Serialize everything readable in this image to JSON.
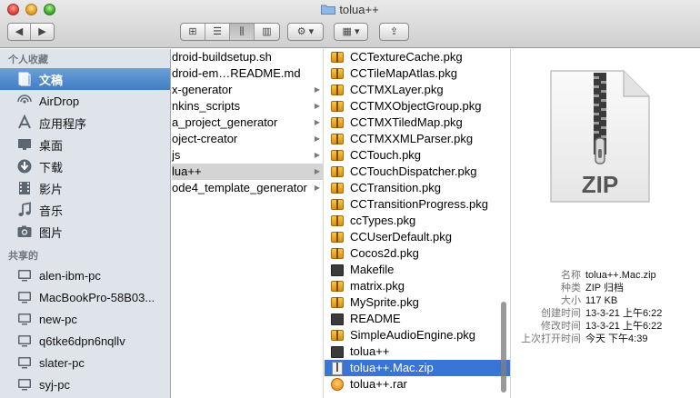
{
  "window": {
    "title": "tolua++"
  },
  "toolbar": {
    "back_glyph": "◀",
    "forward_glyph": "▶",
    "view_icon_glyph": "⊞",
    "view_list_glyph": "☰",
    "view_columns_glyph": "⫼",
    "view_coverflow_glyph": "▥",
    "action_glyph": "⚙ ▾",
    "arrange_glyph": "▦ ▾",
    "share_glyph": "⇪"
  },
  "sidebar": {
    "favorites_header": "个人收藏",
    "favorites": [
      {
        "label": "文稿",
        "icon": "documents-icon"
      },
      {
        "label": "AirDrop",
        "icon": "airdrop-icon"
      },
      {
        "label": "应用程序",
        "icon": "applications-icon"
      },
      {
        "label": "桌面",
        "icon": "desktop-icon"
      },
      {
        "label": "下载",
        "icon": "downloads-icon"
      },
      {
        "label": "影片",
        "icon": "movies-icon"
      },
      {
        "label": "音乐",
        "icon": "music-icon"
      },
      {
        "label": "图片",
        "icon": "pictures-icon"
      }
    ],
    "shared_header": "共享的",
    "shared": [
      {
        "label": "alen-ibm-pc"
      },
      {
        "label": "MacBookPro-58B03..."
      },
      {
        "label": "new-pc"
      },
      {
        "label": "q6tke6dpn6nqllv"
      },
      {
        "label": "slater-pc"
      },
      {
        "label": "syj-pc"
      }
    ]
  },
  "column1": {
    "items": [
      {
        "label": "droid-buildsetup.sh",
        "folder": false
      },
      {
        "label": "droid-em…README.md",
        "folder": false
      },
      {
        "label": "x-generator",
        "folder": true
      },
      {
        "label": "nkins_scripts",
        "folder": true
      },
      {
        "label": "a_project_generator",
        "folder": true
      },
      {
        "label": "oject-creator",
        "folder": true
      },
      {
        "label": "js",
        "folder": true
      },
      {
        "label": "lua++",
        "folder": true
      },
      {
        "label": "ode4_template_generator",
        "folder": true
      }
    ]
  },
  "column2": {
    "items": [
      {
        "label": "CCTextureCache.pkg",
        "icon": "package-icon"
      },
      {
        "label": "CCTileMapAtlas.pkg",
        "icon": "package-icon"
      },
      {
        "label": "CCTMXLayer.pkg",
        "icon": "package-icon"
      },
      {
        "label": "CCTMXObjectGroup.pkg",
        "icon": "package-icon"
      },
      {
        "label": "CCTMXTiledMap.pkg",
        "icon": "package-icon"
      },
      {
        "label": "CCTMXXMLParser.pkg",
        "icon": "package-icon"
      },
      {
        "label": "CCTouch.pkg",
        "icon": "package-icon"
      },
      {
        "label": "CCTouchDispatcher.pkg",
        "icon": "package-icon"
      },
      {
        "label": "CCTransition.pkg",
        "icon": "package-icon"
      },
      {
        "label": "CCTransitionProgress.pkg",
        "icon": "package-icon"
      },
      {
        "label": "ccTypes.pkg",
        "icon": "package-icon"
      },
      {
        "label": "CCUserDefault.pkg",
        "icon": "package-icon"
      },
      {
        "label": "Cocos2d.pkg",
        "icon": "package-icon"
      },
      {
        "label": "Makefile",
        "icon": "unix-executable-icon"
      },
      {
        "label": "matrix.pkg",
        "icon": "package-icon"
      },
      {
        "label": "MySprite.pkg",
        "icon": "package-icon"
      },
      {
        "label": "README",
        "icon": "unix-executable-icon"
      },
      {
        "label": "SimpleAudioEngine.pkg",
        "icon": "package-icon"
      },
      {
        "label": "tolua++",
        "icon": "unix-executable-icon"
      },
      {
        "label": "tolua++.Mac.zip",
        "icon": "zip-file-icon"
      },
      {
        "label": "tolua++.rar",
        "icon": "rar-file-icon"
      }
    ]
  },
  "preview": {
    "icon_label": "ZIP",
    "meta": [
      {
        "key": "名称",
        "value": "tolua++.Mac.zip"
      },
      {
        "key": "种类",
        "value": "ZIP 归档"
      },
      {
        "key": "大小",
        "value": "117 KB"
      },
      {
        "key": "创建时间",
        "value": "13-3-21 上午6:22"
      },
      {
        "key": "修改时间",
        "value": "13-3-21 上午6:22"
      },
      {
        "key": "上次打开时间",
        "value": "今天 下午4:39"
      }
    ]
  },
  "colors": {
    "selection_blue": "#3875d7",
    "sidebar_bg": "#dfe4ea",
    "sidebar_selected": "#3f7ec4"
  }
}
